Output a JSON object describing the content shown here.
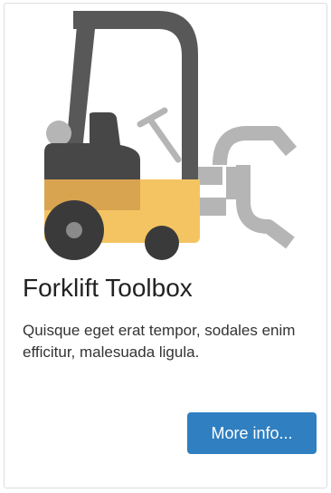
{
  "card": {
    "icon": "forklift-icon",
    "title": "Forklift Toolbox",
    "description": "Quisque eget erat tempor, sodales enim efficitur, malesuada ligula.",
    "button_label": "More info..."
  },
  "colors": {
    "forklift_body": "#f5c462",
    "forklift_body_shade": "#d9a44f",
    "mast": "#585858",
    "cab": "#474747",
    "wheel": "#3a3a3a",
    "clamp": "#b5b5b5",
    "button": "#2f7fc1"
  }
}
